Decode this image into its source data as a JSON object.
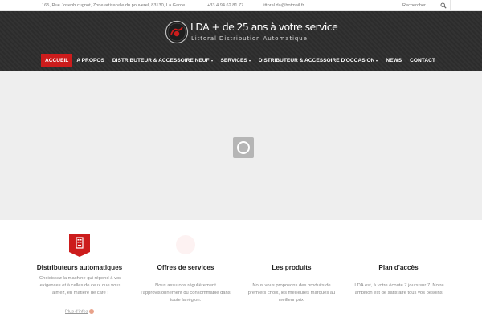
{
  "topbar": {
    "address": "165, Rue Joseph cugnot, Zone artisanale du pouverel, 83130, La Garde",
    "phone": "+33 4 94 62 81 77",
    "email": "littoral.da@hotmail.fr",
    "search_placeholder": "Rechercher ..."
  },
  "brand": {
    "tagline": "LDA + de 25 ans à votre service",
    "subtitle": "Littoral Distribution Automatique"
  },
  "nav": {
    "items": [
      {
        "label": "ACCUEIL",
        "active": true,
        "dropdown": false
      },
      {
        "label": "A PROPOS",
        "active": false,
        "dropdown": false
      },
      {
        "label": "DISTRIBUTEUR & ACCESSOIRE NEUF",
        "active": false,
        "dropdown": true
      },
      {
        "label": "SERVICES",
        "active": false,
        "dropdown": true
      },
      {
        "label": "DISTRIBUTEUR & ACCESSOIRE D'OCCASION",
        "active": false,
        "dropdown": true
      },
      {
        "label": "NEWS",
        "active": false,
        "dropdown": false
      },
      {
        "label": "CONTACT",
        "active": false,
        "dropdown": false
      }
    ]
  },
  "features": [
    {
      "title": "Distributeurs automatiques",
      "text": "Choisissez la machine qui répond à vos exigences et à celles de ceux que vous aimez, en matière de café !",
      "more": "Plus d'infos",
      "icon": "vending-machine-icon"
    },
    {
      "title": "Offres de services",
      "text": "Nous assurons régulièrement l'approvisionnement du consommable dans toute la région.",
      "icon": "service-icon"
    },
    {
      "title": "Les produits",
      "text": "Nous vous proposons des produits de premiers choix, les meilleures marques au meilleur prix.",
      "icon": "products-icon"
    },
    {
      "title": "Plan d'accès",
      "text": "LDA est, à votre écoute 7 jours sur 7. Notre ambition est de satisfaire tous vos besoins.",
      "icon": "map-icon"
    }
  ],
  "colors": {
    "accent": "#cc1c1c",
    "header_bg": "#2c2c2c",
    "slider_bg": "#eeeeee"
  }
}
